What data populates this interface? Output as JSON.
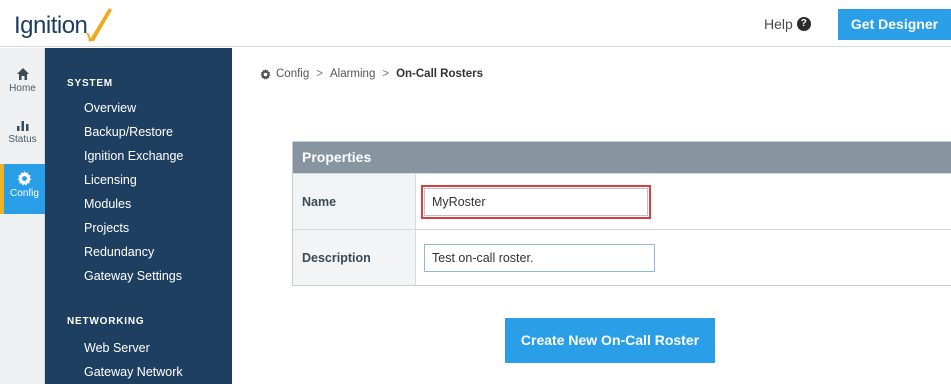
{
  "header": {
    "logo_text": "Ignition",
    "help_label": "Help",
    "help_icon": "question-circle-icon",
    "get_designer_label": "Get Designer"
  },
  "rail": {
    "items": [
      {
        "label": "Home",
        "icon": "home-icon"
      },
      {
        "label": "Status",
        "icon": "bar-chart-icon"
      },
      {
        "label": "Config",
        "icon": "gear-icon",
        "active": true
      }
    ]
  },
  "sidenav": {
    "sections": [
      {
        "heading": "SYSTEM",
        "items": [
          "Overview",
          "Backup/Restore",
          "Ignition Exchange",
          "Licensing",
          "Modules",
          "Projects",
          "Redundancy",
          "Gateway Settings"
        ]
      },
      {
        "heading": "NETWORKING",
        "items": [
          "Web Server",
          "Gateway Network"
        ]
      }
    ]
  },
  "breadcrumb": {
    "items": [
      "Config",
      "Alarming",
      "On-Call Rosters"
    ],
    "separator": ">"
  },
  "properties": {
    "title": "Properties",
    "name_label": "Name",
    "name_value": "MyRoster",
    "description_label": "Description",
    "description_value": "Test on-call roster."
  },
  "actions": {
    "create_label": "Create New On-Call Roster"
  },
  "colors": {
    "accent": "#2a9fe8",
    "sidenav_bg": "#1f3f61",
    "active_marker": "#f0b323",
    "panel_header": "#8795a1",
    "highlight": "#e03c3c"
  }
}
